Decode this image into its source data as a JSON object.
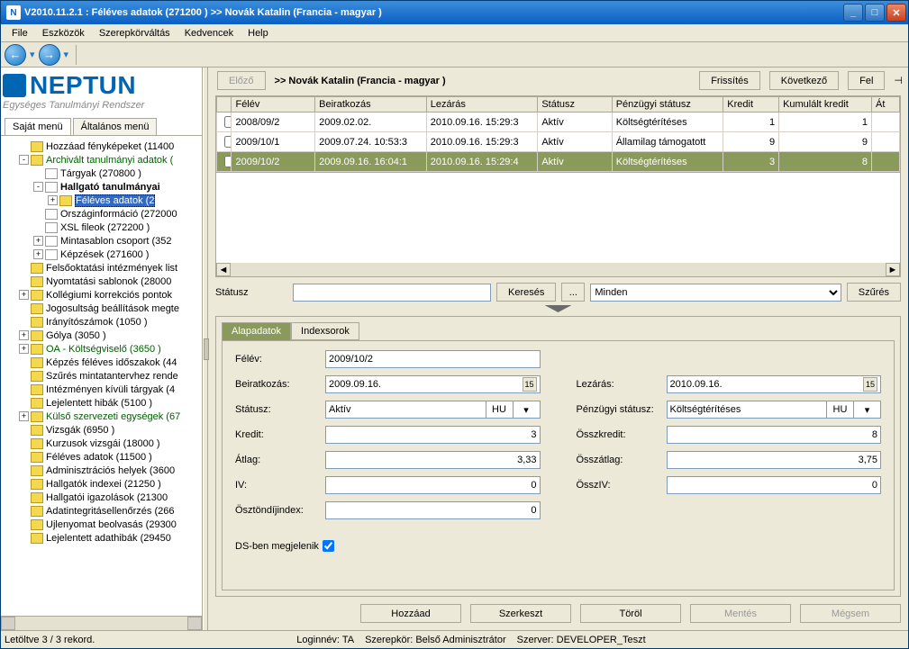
{
  "window": {
    "title": "V2010.11.2.1 : Féléves adatok (271200   )   >> Novák Katalin (Francia - magyar )"
  },
  "menu": {
    "file": "File",
    "tools": "Eszközök",
    "role": "Szerepkörváltás",
    "fav": "Kedvencek",
    "help": "Help"
  },
  "logo": {
    "title": "NEPTUN",
    "sub": "Egységes Tanulmányi Rendszer"
  },
  "leftTabs": {
    "own": "Saját menü",
    "general": "Általános menü"
  },
  "tree": [
    {
      "d": 1,
      "e": "",
      "i": "f",
      "t": "Hozzáad fényképeket (11400"
    },
    {
      "d": 1,
      "e": "-",
      "i": "f",
      "t": "Archivált tanulmányi adatok (",
      "cls": "green"
    },
    {
      "d": 2,
      "e": "",
      "i": "p",
      "t": "Tárgyak (270800   )"
    },
    {
      "d": 2,
      "e": "-",
      "i": "p",
      "t": "Hallgató tanulmányai",
      "cls": "bold"
    },
    {
      "d": 3,
      "e": "+",
      "i": "f",
      "t": "Féléves adatok (2",
      "cls": "sel green"
    },
    {
      "d": 2,
      "e": "",
      "i": "p",
      "t": "Országinformáció (272000"
    },
    {
      "d": 2,
      "e": "",
      "i": "p",
      "t": "XSL fileok (272200   )"
    },
    {
      "d": 2,
      "e": "+",
      "i": "p",
      "t": "Mintasablon csoport (352"
    },
    {
      "d": 2,
      "e": "+",
      "i": "p",
      "t": "Képzések (271600   )"
    },
    {
      "d": 1,
      "e": "",
      "i": "f",
      "t": "Felsőoktatási intézmények list"
    },
    {
      "d": 1,
      "e": "",
      "i": "f",
      "t": "Nyomtatási sablonok (28000"
    },
    {
      "d": 1,
      "e": "+",
      "i": "f",
      "t": "Kollégiumi korrekciós pontok"
    },
    {
      "d": 1,
      "e": "",
      "i": "f",
      "t": "Jogosultság beállítások megte"
    },
    {
      "d": 1,
      "e": "",
      "i": "f",
      "t": "Irányítószámok (1050   )"
    },
    {
      "d": 1,
      "e": "+",
      "i": "f",
      "t": "Gólya (3050   )"
    },
    {
      "d": 1,
      "e": "+",
      "i": "f",
      "t": "OA - Költségviselő (3650   )",
      "cls": "green"
    },
    {
      "d": 1,
      "e": "",
      "i": "f",
      "t": "Képzés féléves időszakok (44"
    },
    {
      "d": 1,
      "e": "",
      "i": "f",
      "t": "Szűrés mintatantervhez rende"
    },
    {
      "d": 1,
      "e": "",
      "i": "f",
      "t": "Intézményen kívüli tárgyak (4"
    },
    {
      "d": 1,
      "e": "",
      "i": "f",
      "t": "Lejelentett hibák (5100   )"
    },
    {
      "d": 1,
      "e": "+",
      "i": "f",
      "t": "Külső szervezeti egységek (67",
      "cls": "green"
    },
    {
      "d": 1,
      "e": "",
      "i": "f",
      "t": "Vizsgák (6950   )"
    },
    {
      "d": 1,
      "e": "",
      "i": "f",
      "t": "Kurzusok vizsgái (18000   )"
    },
    {
      "d": 1,
      "e": "",
      "i": "f",
      "t": "Féléves adatok (11500   )"
    },
    {
      "d": 1,
      "e": "",
      "i": "f",
      "t": "Adminisztrációs helyek (3600"
    },
    {
      "d": 1,
      "e": "",
      "i": "f",
      "t": "Hallgatók indexei (21250   )"
    },
    {
      "d": 1,
      "e": "",
      "i": "f",
      "t": "Hallgatói igazolások (21300"
    },
    {
      "d": 1,
      "e": "",
      "i": "f",
      "t": "Adatintegritásellenőrzés (266"
    },
    {
      "d": 1,
      "e": "",
      "i": "f",
      "t": "Ujlenyomat beolvasás (29300"
    },
    {
      "d": 1,
      "e": "",
      "i": "f",
      "t": "Lejelentett adathibák (29450"
    }
  ],
  "top": {
    "prev": "Előző",
    "breadcrumb": ">>  Novák Katalin (Francia - magyar )",
    "refresh": "Frissítés",
    "next": "Következő",
    "up": "Fel"
  },
  "grid": {
    "cols": [
      "Félév",
      "Beiratkozás",
      "Lezárás",
      "Státusz",
      "Pénzügyi státusz",
      "Kredit",
      "Kumulált kredit",
      "Át"
    ],
    "rows": [
      {
        "felev": "2008/09/2",
        "beir": "2009.02.02.",
        "lez": "2010.09.16. 15:29:3",
        "stat": "Aktív",
        "pstat": "Költségtérítéses",
        "kredit": "1",
        "kum": "1"
      },
      {
        "felev": "2009/10/1",
        "beir": "2009.07.24. 10:53:3",
        "lez": "2010.09.16. 15:29:3",
        "stat": "Aktív",
        "pstat": "Államilag támogatott",
        "kredit": "9",
        "kum": "9"
      },
      {
        "felev": "2009/10/2",
        "beir": "2009.09.16. 16:04:1",
        "lez": "2010.09.16. 15:29:4",
        "stat": "Aktív",
        "pstat": "Költségtérítéses",
        "kredit": "3",
        "kum": "8",
        "sel": true
      }
    ]
  },
  "search": {
    "label": "Státusz",
    "searchBtn": "Keresés",
    "ell": "...",
    "scope": "Minden",
    "filter": "Szűrés"
  },
  "detailTabs": {
    "main": "Alapadatok",
    "index": "Indexsorok"
  },
  "detail": {
    "felevL": "Félév:",
    "felev": "2009/10/2",
    "beirL": "Beiratkozás:",
    "beir": "2009.09.16.",
    "lezL": "Lezárás:",
    "lez": "2010.09.16.",
    "statL": "Státusz:",
    "stat": "Aktív",
    "statLang": "HU",
    "pstatL": "Pénzügyi státusz:",
    "pstat": "Költségtérítéses",
    "pstatLang": "HU",
    "kreditL": "Kredit:",
    "kredit": "3",
    "osszkreditL": "Összkredit:",
    "osszkredit": "8",
    "atlagL": "Átlag:",
    "atlag": "3,33",
    "osszatlagL": "Összátlag:",
    "osszatlag": "3,75",
    "ivL": "IV:",
    "iv": "0",
    "osszivL": "ÖsszIV:",
    "ossziv": "0",
    "osztL": "Ösztöndíjindex:",
    "oszt": "0",
    "dsL": "DS-ben megjelenik"
  },
  "actions": {
    "add": "Hozzáad",
    "edit": "Szerkeszt",
    "del": "Töröl",
    "save": "Mentés",
    "cancel": "Mégsem"
  },
  "status": {
    "records": "Letöltve 3 / 3 rekord.",
    "login": "Loginnév: TA",
    "role": "Szerepkör: Belső Adminisztrátor",
    "server": "Szerver: DEVELOPER_Teszt"
  }
}
